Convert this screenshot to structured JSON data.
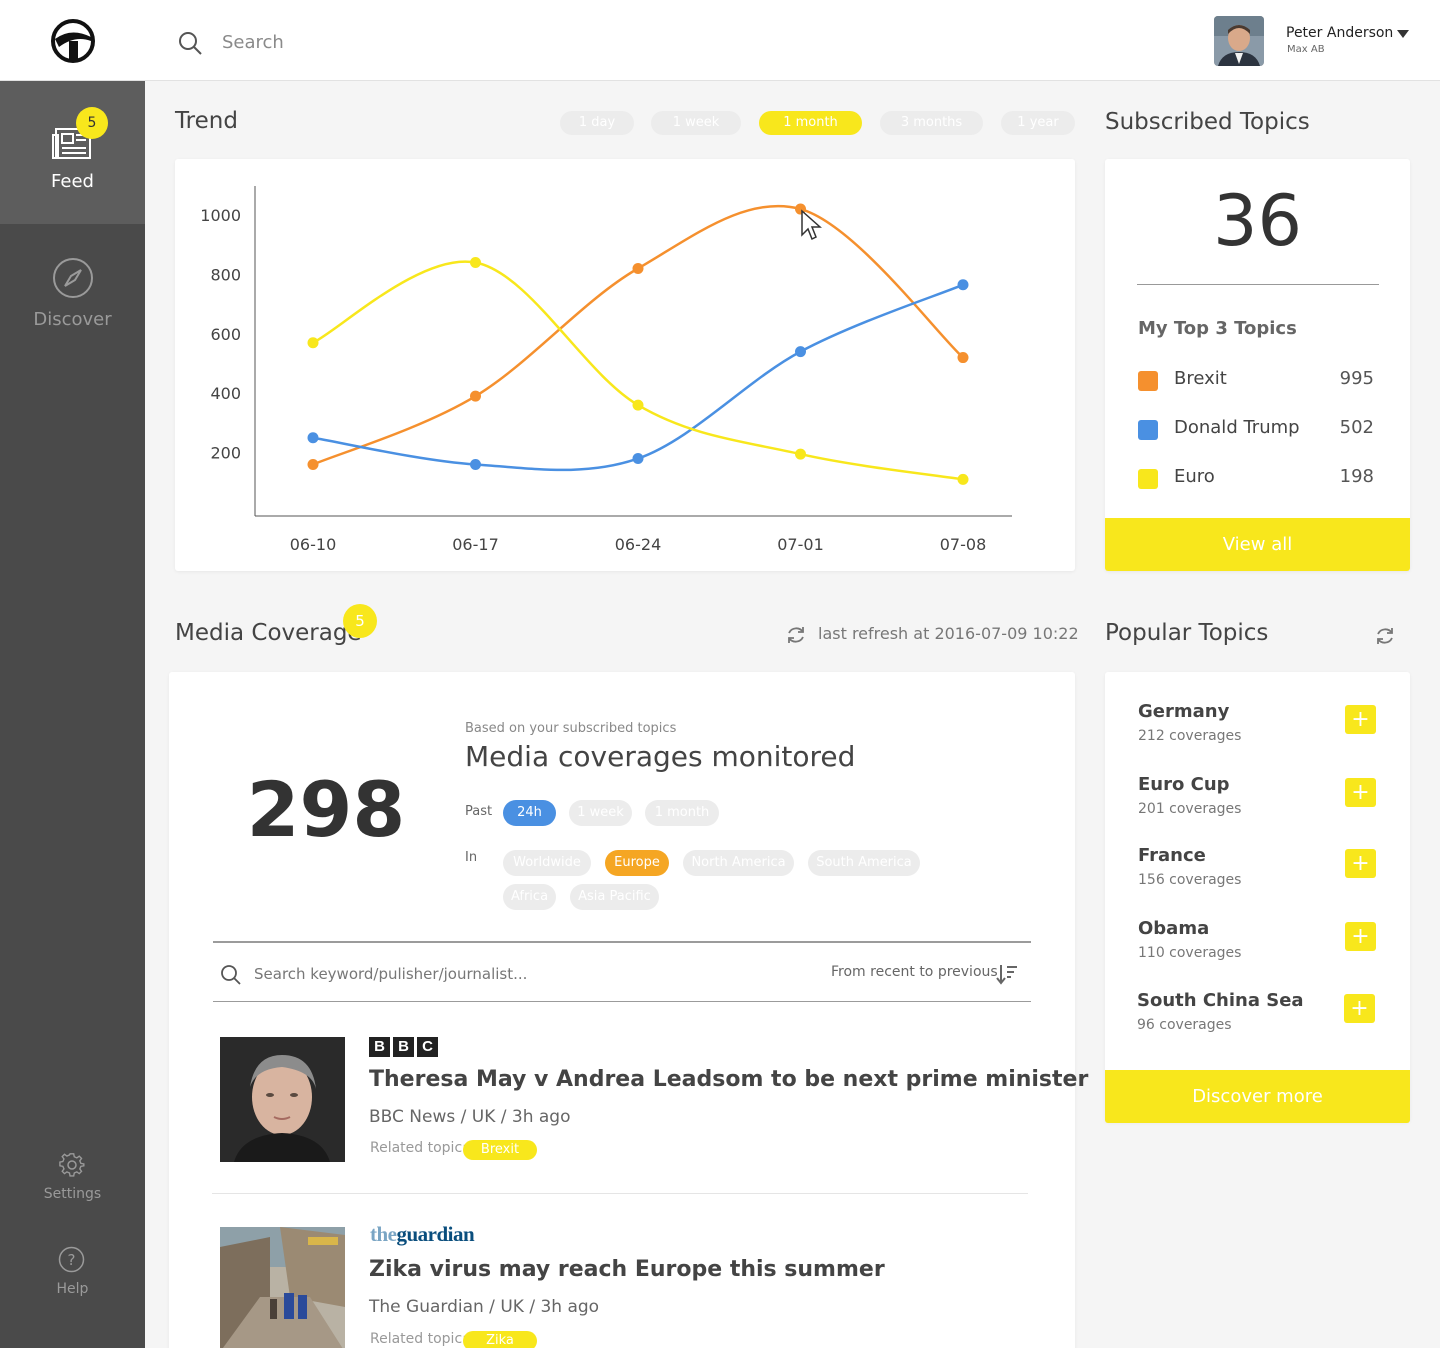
{
  "header": {
    "search_placeholder": "Search",
    "user_name": "Peter Anderson",
    "user_company": "Max AB"
  },
  "sidebar": {
    "feed_label": "Feed",
    "feed_badge": "5",
    "discover_label": "Discover",
    "settings_label": "Settings",
    "help_label": "Help"
  },
  "trend": {
    "title": "Trend",
    "ranges": [
      "1 day",
      "1 week",
      "1 month",
      "3 months",
      "1 year"
    ],
    "active_range": "1 month"
  },
  "chart_data": {
    "type": "line",
    "categories": [
      "06-10",
      "06-17",
      "06-24",
      "07-01",
      "07-08"
    ],
    "series": [
      {
        "name": "Brexit",
        "color": "#f5902e",
        "values": [
          160,
          390,
          820,
          1020,
          520
        ]
      },
      {
        "name": "Donald Trump",
        "color": "#4a90e2",
        "values": [
          250,
          160,
          180,
          540,
          765
        ]
      },
      {
        "name": "Euro",
        "color": "#f8e71c",
        "values": [
          570,
          840,
          360,
          195,
          110
        ]
      }
    ],
    "yticks": [
      "200",
      "400",
      "600",
      "800",
      "1000"
    ],
    "ylim": [
      0,
      1100
    ],
    "grid": false,
    "legend": "none"
  },
  "subscribed": {
    "title": "Subscribed Topics",
    "count": "36",
    "top_title": "My Top 3 Topics",
    "top": [
      {
        "name": "Brexit",
        "value": "995",
        "color": "#f5902e"
      },
      {
        "name": "Donald Trump",
        "value": "502",
        "color": "#4a90e2"
      },
      {
        "name": "Euro",
        "value": "198",
        "color": "#f8e71c"
      }
    ],
    "view_all": "View all"
  },
  "media": {
    "title": "Media Coverage",
    "badge": "5",
    "last_refresh": "last refresh at 2016-07-09 10:22",
    "count": "298",
    "subtitle": "Based on your subscribed topics",
    "headline": "Media coverages monitored",
    "past_label": "Past",
    "past_options": [
      "24h",
      "1 week",
      "1 month"
    ],
    "in_label": "In",
    "regions": [
      "Worldwide",
      "Europe",
      "North America",
      "South America",
      "Africa",
      "Asia Pacific"
    ],
    "search_placeholder": "Search keyword/pulisher/journalist...",
    "sort_label": "From recent to previous",
    "articles": [
      {
        "source_logo": "BBC",
        "headline": "Theresa May v Andrea Leadsom to be next prime minister",
        "meta": "BBC News / UK / 3h ago",
        "related_label": "Related topic:",
        "topic": "Brexit"
      },
      {
        "source_logo": "theguardian",
        "headline": "Zika virus may reach Europe this summer",
        "meta": "The Guardian / UK / 3h ago",
        "related_label": "Related topic:",
        "topic": "Zika"
      }
    ]
  },
  "popular": {
    "title": "Popular Topics",
    "items": [
      {
        "name": "Germany",
        "count": "212 coverages"
      },
      {
        "name": "Euro Cup",
        "count": "201 coverages"
      },
      {
        "name": "France",
        "count": "156 coverages"
      },
      {
        "name": "Obama",
        "count": "110 coverages"
      },
      {
        "name": "South China Sea",
        "count": "96 coverages"
      }
    ],
    "add_symbol": "+",
    "discover_more": "Discover more"
  },
  "colors": {
    "accent": "#f8e71c",
    "blue": "#4a90e2",
    "orange": "#f5a623",
    "sidebar": "#4a4a4a"
  }
}
